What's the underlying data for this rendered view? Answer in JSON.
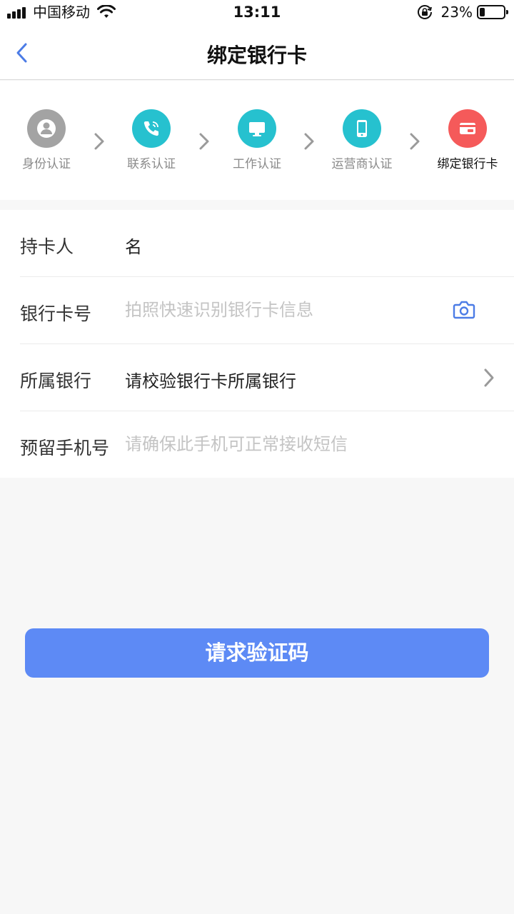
{
  "status_bar": {
    "carrier": "中国移动",
    "time": "13:11",
    "battery_percent": "23%",
    "battery_level": 0.23
  },
  "nav": {
    "title": "绑定银行卡",
    "back_icon": "chevron-left-icon"
  },
  "steps": [
    {
      "label": "身份认证",
      "icon": "user-icon",
      "color": "#a3a3a3"
    },
    {
      "label": "联系认证",
      "icon": "phone-icon",
      "color": "#26c1cf"
    },
    {
      "label": "工作认证",
      "icon": "monitor-icon",
      "color": "#26c1cf"
    },
    {
      "label": "运营商认证",
      "icon": "mobile-icon",
      "color": "#26c1cf"
    },
    {
      "label": "绑定银行卡",
      "icon": "card-icon",
      "color": "#f55a5a",
      "active": true
    }
  ],
  "form": {
    "cardholder_label": "持卡人",
    "cardholder_value": "名",
    "card_number_label": "银行卡号",
    "card_number_placeholder": "拍照快速识别银行卡信息",
    "bank_label": "所属银行",
    "bank_value": "请校验银行卡所属银行",
    "phone_label": "预留手机号",
    "phone_placeholder": "请确保此手机可正常接收短信"
  },
  "submit_label": "请求验证码",
  "colors": {
    "accent": "#5d8af5",
    "step_teal": "#26c1cf",
    "step_red": "#f55a5a",
    "step_gray": "#a3a3a3"
  }
}
